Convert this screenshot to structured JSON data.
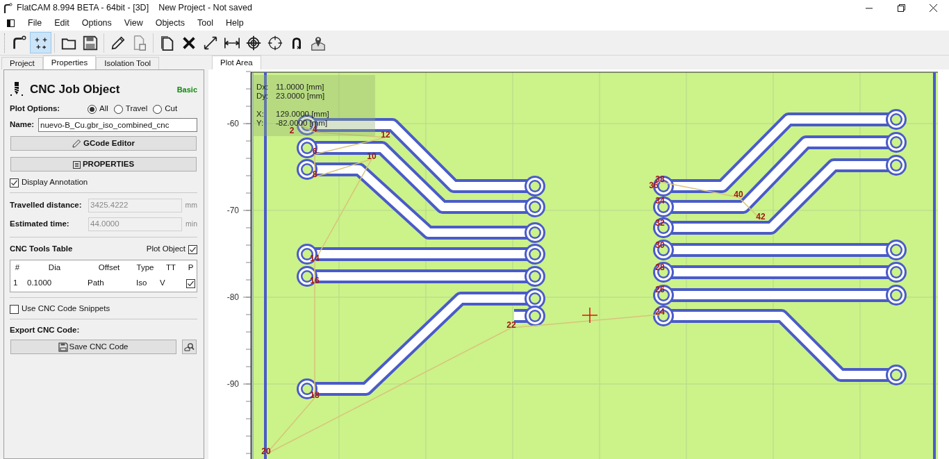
{
  "window": {
    "title": "FlatCAM 8.994 BETA - 64bit - [3D]",
    "project": "New Project - Not saved"
  },
  "menu": [
    "File",
    "Edit",
    "Options",
    "View",
    "Objects",
    "Tool",
    "Help"
  ],
  "toolbar": [
    {
      "kind": "pipe",
      "selected": false
    },
    {
      "kind": "dots",
      "selected": true
    },
    {
      "kind": "folder",
      "selected": false
    },
    {
      "kind": "save",
      "selected": false
    },
    {
      "kind": "pencil",
      "selected": false
    },
    {
      "kind": "docsave",
      "selected": false
    },
    {
      "kind": "copy",
      "selected": false
    },
    {
      "kind": "delete",
      "selected": false
    },
    {
      "kind": "fit",
      "selected": false
    },
    {
      "kind": "measure",
      "selected": false
    },
    {
      "kind": "target",
      "selected": false
    },
    {
      "kind": "crosshair",
      "selected": false
    },
    {
      "kind": "magnet",
      "selected": false
    },
    {
      "kind": "pin",
      "selected": false
    }
  ],
  "left_tabs": [
    {
      "label": "Project",
      "selected": false
    },
    {
      "label": "Properties",
      "selected": true
    },
    {
      "label": "Isolation Tool",
      "selected": false
    }
  ],
  "plot_tabs": [
    {
      "label": "Plot Area",
      "selected": true
    }
  ],
  "panel": {
    "title": "CNC Job Object",
    "mode": "Basic",
    "plot_options": {
      "label": "Plot Options:",
      "options": [
        {
          "label": "All",
          "selected": true
        },
        {
          "label": "Travel",
          "selected": false
        },
        {
          "label": "Cut",
          "selected": false
        }
      ]
    },
    "name": {
      "label": "Name:",
      "value": "nuevo-B_Cu.gbr_iso_combined_cnc"
    },
    "gcode_button": "GCode Editor",
    "properties_button": "PROPERTIES",
    "display_annotation": {
      "label": "Display Annotation",
      "checked": true
    },
    "travelled": {
      "label": "Travelled distance:",
      "value": "3425.4222",
      "unit": "mm"
    },
    "estimated": {
      "label": "Estimated time:",
      "value": "44.0000",
      "unit": "min"
    },
    "tools_table": {
      "title": "CNC Tools Table",
      "plot_object": {
        "label": "Plot Object",
        "checked": true
      },
      "columns": [
        "#",
        "Dia",
        "Offset",
        "Type",
        "TT",
        "P"
      ],
      "rows": [
        {
          "cells": [
            "1",
            "0.1000",
            "Path",
            "Iso",
            "V"
          ],
          "checked": true
        }
      ]
    },
    "snippets": {
      "label": "Use CNC Code Snippets",
      "checked": false
    },
    "export": {
      "label": "Export CNC Code:",
      "save_button": "Save CNC Code"
    }
  },
  "plot": {
    "y_ticks": [
      "-60",
      "-70",
      "-80",
      "-90"
    ],
    "measure": [
      {
        "label": "Dx:",
        "value": "11.0000 [mm]"
      },
      {
        "label": "Dy:",
        "value": "23.0000 [mm]"
      },
      {
        "label": "X:",
        "value": "129.0000 [mm]"
      },
      {
        "label": "Y:",
        "value": "-82.0000 [mm]"
      }
    ],
    "annotations": [
      "2",
      "4",
      "12",
      "6",
      "10",
      "8",
      "38",
      "36",
      "40",
      "34",
      "42",
      "32",
      "30",
      "14",
      "28",
      "16",
      "26",
      "24",
      "22",
      "18",
      "20"
    ]
  }
}
